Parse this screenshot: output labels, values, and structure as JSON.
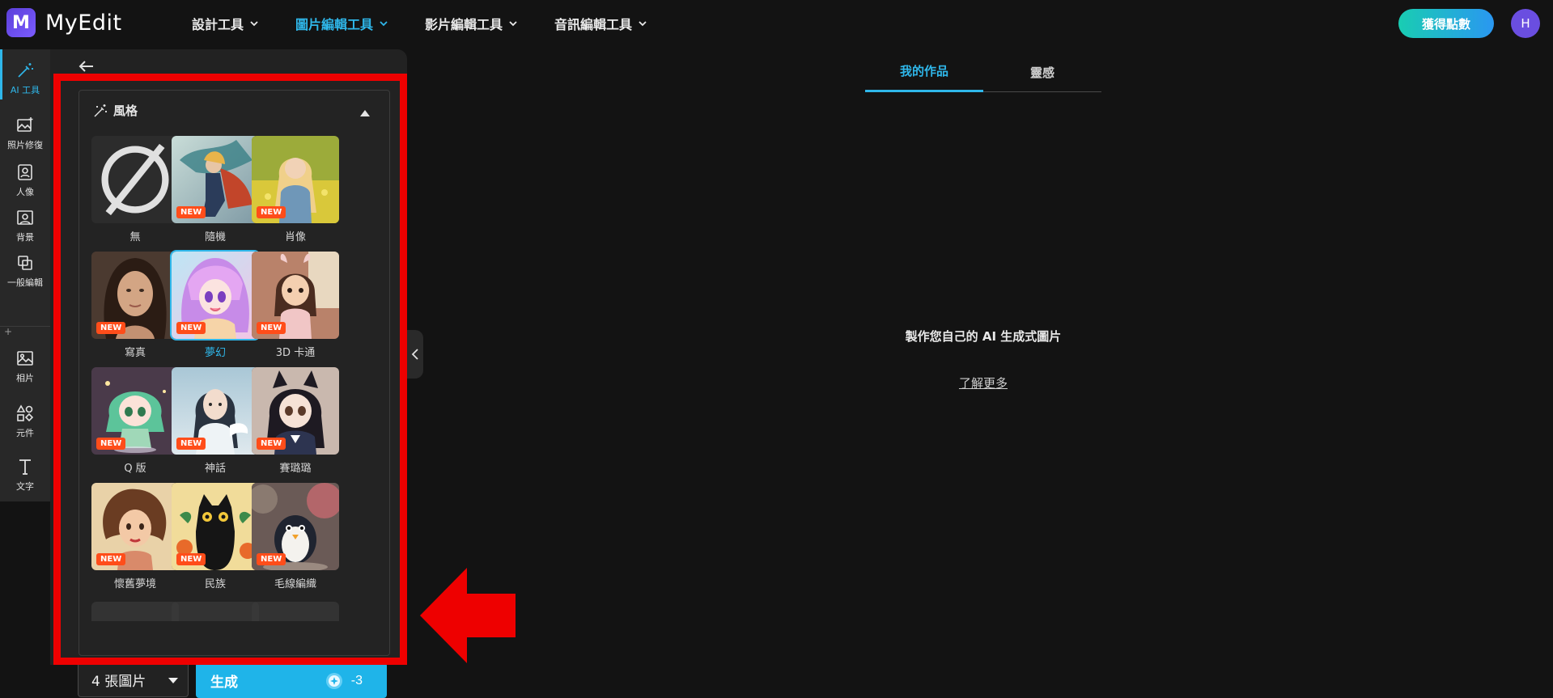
{
  "app": {
    "name": "MyEdit",
    "logo_letter": "M"
  },
  "nav": [
    {
      "label": "設計工具",
      "active": false
    },
    {
      "label": "圖片編輯工具",
      "active": true
    },
    {
      "label": "影片編輯工具",
      "active": false
    },
    {
      "label": "音訊編輯工具",
      "active": false
    }
  ],
  "header": {
    "points_button": "獲得點數",
    "avatar_initial": "H"
  },
  "rail": [
    {
      "label": "AI 工具",
      "icon": "magic-wand-icon",
      "active": true
    },
    {
      "label": "照片修復",
      "icon": "image-restore-icon"
    },
    {
      "label": "人像",
      "icon": "portrait-icon"
    },
    {
      "label": "背景",
      "icon": "background-icon"
    },
    {
      "label": "一般編輯",
      "icon": "layers-icon"
    },
    {
      "label": "相片",
      "icon": "photo-icon"
    },
    {
      "label": "元件",
      "icon": "shapes-icon"
    },
    {
      "label": "文字",
      "icon": "text-icon"
    }
  ],
  "style_panel": {
    "title": "風格",
    "new_badge": "NEW",
    "tiles": [
      {
        "label": "無",
        "is_new": false,
        "selected": false
      },
      {
        "label": "隨機",
        "is_new": true,
        "selected": false
      },
      {
        "label": "肖像",
        "is_new": true,
        "selected": false
      },
      {
        "label": "寫真",
        "is_new": true,
        "selected": false
      },
      {
        "label": "夢幻",
        "is_new": true,
        "selected": true
      },
      {
        "label": "3D 卡通",
        "is_new": true,
        "selected": false
      },
      {
        "label": "Q 版",
        "is_new": true,
        "selected": false
      },
      {
        "label": "神話",
        "is_new": true,
        "selected": false
      },
      {
        "label": "賽璐璐",
        "is_new": true,
        "selected": false
      },
      {
        "label": "懷舊夢境",
        "is_new": true,
        "selected": false
      },
      {
        "label": "民族",
        "is_new": true,
        "selected": false
      },
      {
        "label": "毛線編織",
        "is_new": true,
        "selected": false
      }
    ]
  },
  "footer": {
    "count_select": "4 張圖片",
    "generate_label": "生成",
    "generate_cost": "-3"
  },
  "right": {
    "tabs": [
      {
        "label": "我的作品",
        "active": true
      },
      {
        "label": "靈感",
        "active": false
      }
    ],
    "empty_title": "製作您自己的 AI 生成式圖片",
    "learn_more": "了解更多"
  },
  "colors": {
    "accent": "#2fb7ea",
    "badge": "#ff4d1a",
    "highlight_frame": "#ee0000"
  }
}
